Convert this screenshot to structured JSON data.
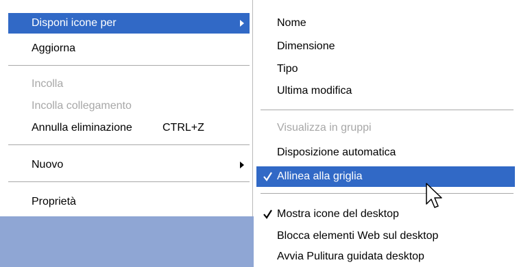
{
  "main_menu": {
    "items": [
      {
        "label": "Disponi icone per"
      },
      {
        "label": "Aggiorna"
      },
      {
        "label": "Incolla"
      },
      {
        "label": "Incolla collegamento"
      },
      {
        "label": "Annulla eliminazione",
        "shortcut": "CTRL+Z"
      },
      {
        "label": "Nuovo"
      },
      {
        "label": "Proprietà"
      }
    ]
  },
  "submenu": {
    "items": [
      {
        "label": "Nome"
      },
      {
        "label": "Dimensione"
      },
      {
        "label": "Tipo"
      },
      {
        "label": "Ultima modifica"
      },
      {
        "label": "Visualizza in gruppi"
      },
      {
        "label": "Disposizione automatica"
      },
      {
        "label": "Allinea alla griglia"
      },
      {
        "label": "Mostra icone del desktop"
      },
      {
        "label": "Blocca elementi Web sul desktop"
      },
      {
        "label": "Avvia Pulitura guidata desktop"
      }
    ]
  },
  "colors": {
    "highlight": "#3169c6",
    "disabled_text": "#a7a7a7",
    "desktop_background": "#8fa6d4"
  },
  "icons": [
    "submenu-arrow-icon",
    "checkmark-icon",
    "mouse-cursor-icon"
  ]
}
